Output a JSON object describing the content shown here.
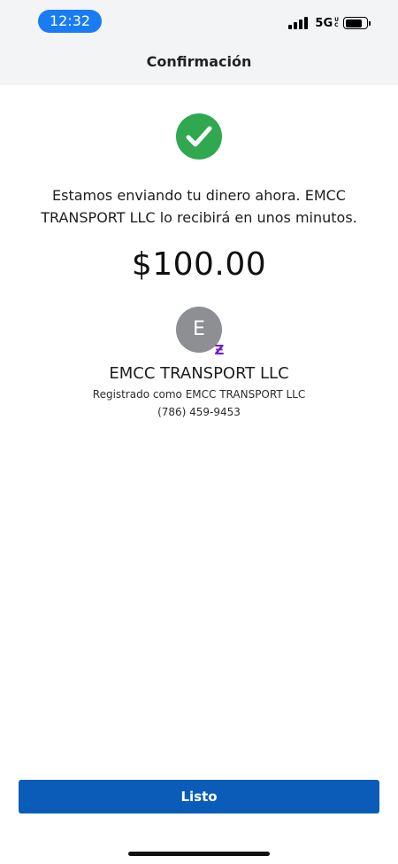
{
  "status_bar": {
    "time": "12:32",
    "network": "5G",
    "network_sub": [
      "U",
      "C"
    ],
    "battery_level": 0.82
  },
  "header": {
    "title": "Confirmación"
  },
  "confirmation": {
    "message": "Estamos enviando tu dinero ahora. EMCC TRANSPORT LLC lo recibirá en unos minutos.",
    "amount": "$100.00",
    "status_color": "#2fa84f"
  },
  "recipient": {
    "avatar_initial": "E",
    "badge_glyph": "Ƶ",
    "badge_color": "#6d1ed4",
    "name": "EMCC TRANSPORT LLC",
    "registered_as": "Registrado como EMCC TRANSPORT LLC",
    "phone": "(786) 459-9453"
  },
  "footer": {
    "done_label": "Listo",
    "button_color": "#0a5cb8"
  }
}
